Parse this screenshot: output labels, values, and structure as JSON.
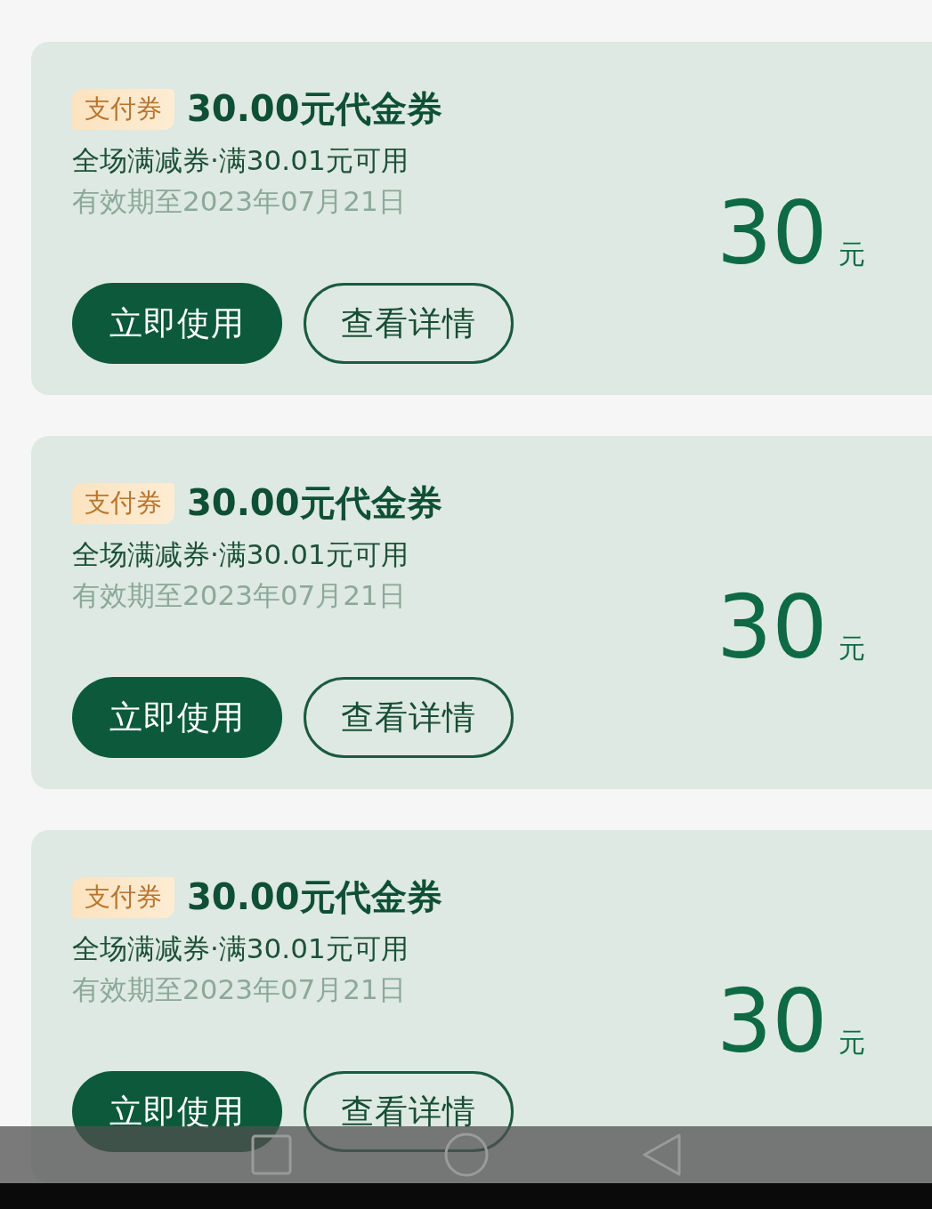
{
  "coupons": [
    {
      "badge": "支付券",
      "title": "30.00元代金券",
      "condition": "全场满减券·满30.01元可用",
      "expiry": "有效期至2023年07月21日",
      "amount": "30",
      "unit": "元",
      "buttons": [
        {
          "label": "立即使用",
          "kind": "filled"
        },
        {
          "label": "查看详情",
          "kind": "outline"
        }
      ]
    },
    {
      "badge": "支付券",
      "title": "30.00元代金券",
      "condition": "全场满减券·满30.01元可用",
      "expiry": "有效期至2023年07月21日",
      "amount": "30",
      "unit": "元",
      "buttons": [
        {
          "label": "立即使用",
          "kind": "filled"
        },
        {
          "label": "查看详情",
          "kind": "outline"
        }
      ]
    },
    {
      "badge": "支付券",
      "title": "30.00元代金券",
      "condition": "全场满减券·满30.01元可用",
      "expiry": "有效期至2023年07月21日",
      "amount": "30",
      "unit": "元",
      "buttons": [
        {
          "label": "立即使用",
          "kind": "filled"
        },
        {
          "label": "查看详情",
          "kind": "outline"
        }
      ]
    }
  ]
}
